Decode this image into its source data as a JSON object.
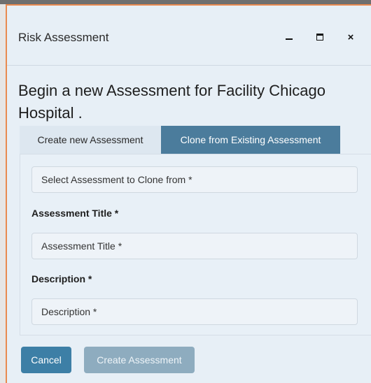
{
  "window": {
    "title": "Risk Assessment",
    "controls": {
      "minimize": "–",
      "maximize": "□",
      "close": "×"
    }
  },
  "heading": "Begin a new Assessment for Facility Chicago Hospital .",
  "tabs": [
    {
      "label": "Create new Assessment",
      "active": false
    },
    {
      "label": "Clone from Existing Assessment",
      "active": true
    }
  ],
  "form": {
    "clone_select": {
      "placeholder": "Select Assessment to Clone from *"
    },
    "title_label": "Assessment Title *",
    "title_field": {
      "placeholder": "Assessment Title *"
    },
    "description_label": "Description *",
    "description_field": {
      "placeholder": "Description *"
    }
  },
  "buttons": {
    "cancel": "Cancel",
    "create": "Create Assessment"
  },
  "colors": {
    "accent": "#3d7fa6",
    "tab_active": "#4b7c9c",
    "disabled_button": "#8eacbf",
    "window_border": "#e98a50"
  }
}
